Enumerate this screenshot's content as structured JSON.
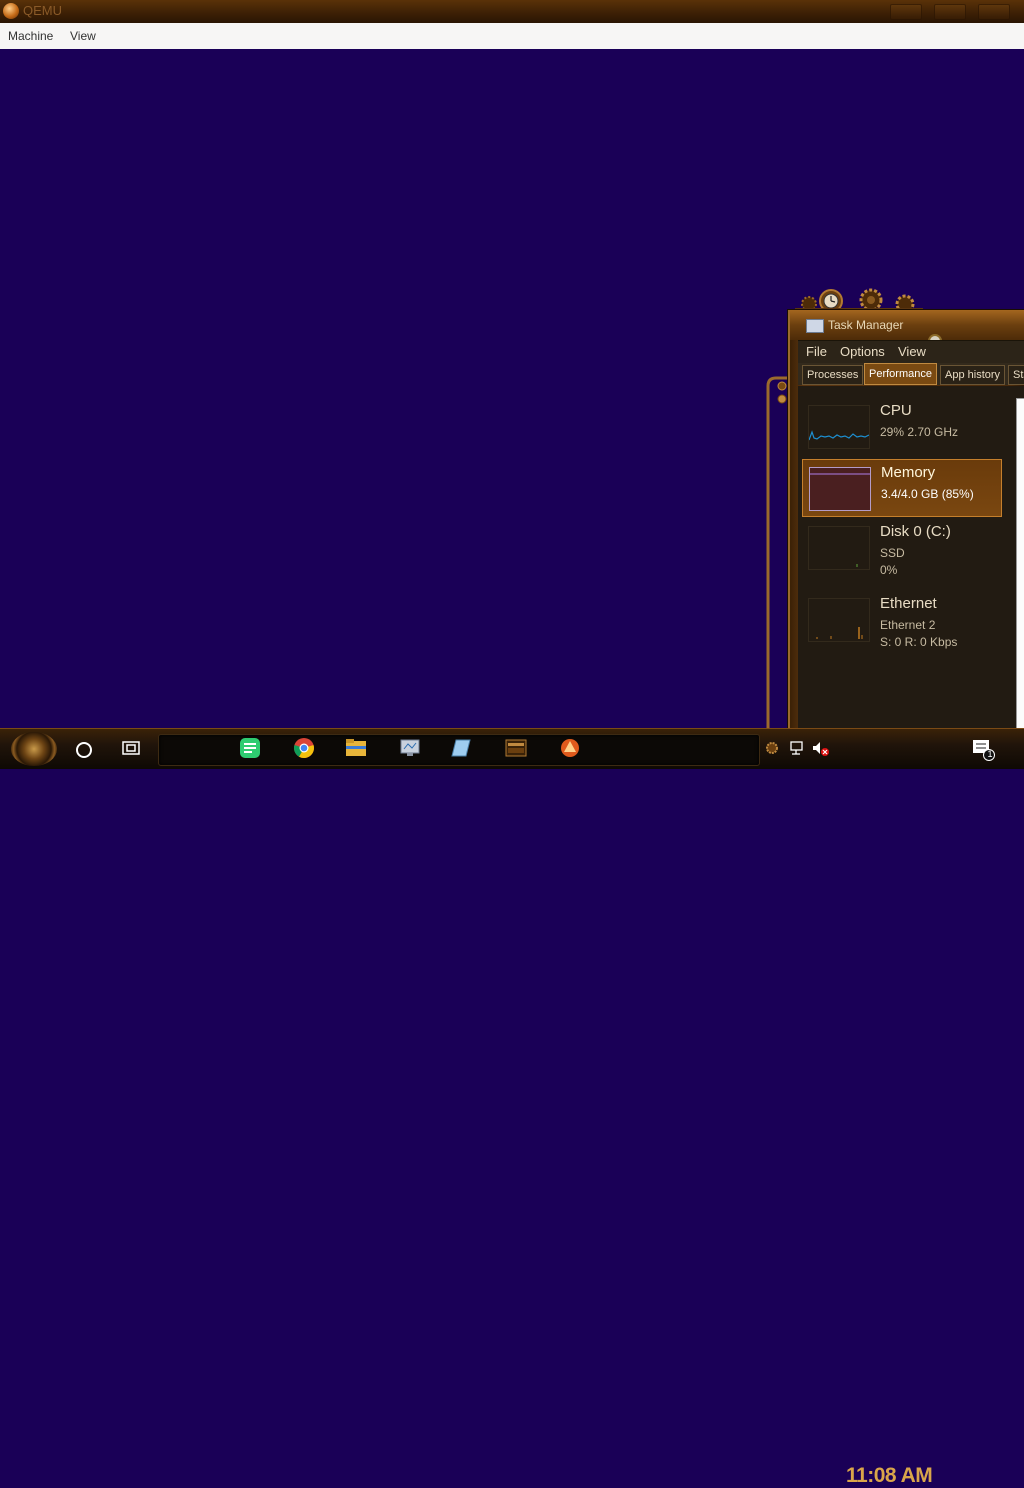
{
  "window": {
    "title": "QEMU",
    "menu": [
      "Machine",
      "View"
    ]
  },
  "task_manager": {
    "title": "Task Manager",
    "menu": [
      "File",
      "Options",
      "View"
    ],
    "tabs": [
      "Processes",
      "Performance",
      "App history",
      "Sta"
    ],
    "active_tab": "Performance",
    "items": [
      {
        "name": "CPU",
        "line1": "29% 2.70 GHz",
        "line2": ""
      },
      {
        "name": "Memory",
        "line1": "3.4/4.0 GB (85%)",
        "line2": ""
      },
      {
        "name": "Disk 0 (C:)",
        "line1": "SSD",
        "line2": "0%"
      },
      {
        "name": "Ethernet",
        "line1": "Ethernet 2",
        "line2": "S: 0 R: 0 Kbps"
      }
    ]
  },
  "taskbar": {
    "clock": "11:08 AM",
    "notification_count": "1",
    "apps": [
      "chat-app-icon",
      "chrome-icon",
      "file-explorer-icon",
      "remote-desktop-icon",
      "notepad-icon",
      "calendar-app-icon",
      "qemu-icon"
    ]
  },
  "colors": {
    "desktop_bg": "#1a0057",
    "accent": "#c57f2c",
    "clock": "#d9a54a"
  }
}
